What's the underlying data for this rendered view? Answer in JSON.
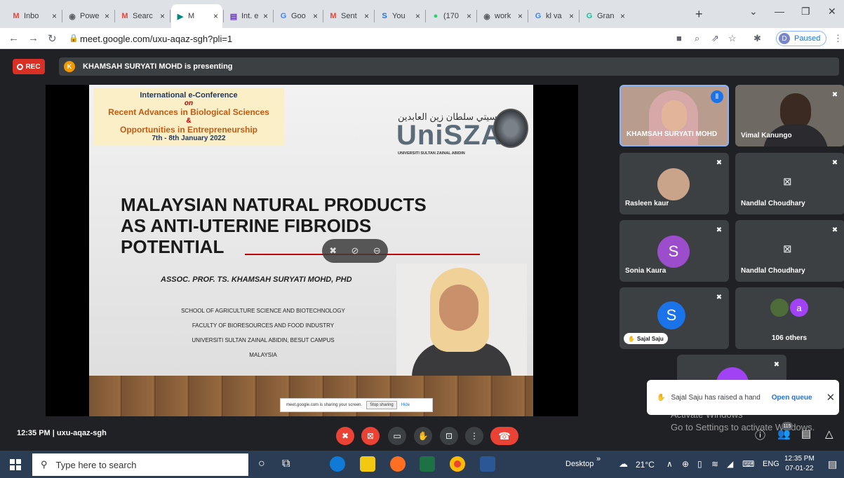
{
  "browser": {
    "tabs": [
      {
        "label": "Inbo",
        "icon": "gmail-icon",
        "color": "#ea4335",
        "glyph": "M"
      },
      {
        "label": "Powe",
        "icon": "chrome-globe-icon",
        "color": "#5f6368",
        "glyph": "◉"
      },
      {
        "label": "Searc",
        "icon": "gmail-icon",
        "color": "#ea4335",
        "glyph": "M"
      },
      {
        "label": "M",
        "icon": "meet-icon",
        "color": "#00897b",
        "glyph": "▶",
        "active": true
      },
      {
        "label": "Int. e",
        "icon": "forms-icon",
        "color": "#673ab7",
        "glyph": "▤"
      },
      {
        "label": "Goo",
        "icon": "google-icon",
        "color": "#4285f4",
        "glyph": "G"
      },
      {
        "label": "Sent",
        "icon": "gmail-icon",
        "color": "#ea4335",
        "glyph": "M"
      },
      {
        "label": "You",
        "icon": "sheet-icon",
        "color": "#1a73e8",
        "glyph": "S"
      },
      {
        "label": "(170",
        "icon": "whatsapp-icon",
        "color": "#25d366",
        "glyph": "●"
      },
      {
        "label": "work",
        "icon": "chrome-globe-icon",
        "color": "#5f6368",
        "glyph": "◉"
      },
      {
        "label": "kl va",
        "icon": "google-icon",
        "color": "#4285f4",
        "glyph": "G"
      },
      {
        "label": "Gran",
        "icon": "grammarly-icon",
        "color": "#15c39a",
        "glyph": "G"
      }
    ],
    "url": "meet.google.com/uxu-aqaz-sgh?pli=1",
    "profile_initial": "D",
    "profile_status": "Paused"
  },
  "meet": {
    "rec_label": "REC",
    "presenter_initial": "K",
    "presenting_text": "KHAMSAH SURYATI MOHD is presenting",
    "slide": {
      "conf_line1": "International e-Conference",
      "conf_line2": "on",
      "conf_line3": "Recent Advances in Biological Sciences",
      "conf_line4": "&",
      "conf_line5": "Opportunities in Entrepreneurship",
      "conf_line6": "7th - 8th January 2022",
      "logo_arabic": "يونيبرسيتي سلطان زين العابدين",
      "logo_text": "UniSZA",
      "logo_sub": "UNIVERSITI SULTAN ZAINAL ABIDIN",
      "title_line1": "MALAYSIAN NATURAL PRODUCTS",
      "title_line2": "AS ANTI-UTERINE FIBROIDS",
      "title_line3": "POTENTIAL",
      "author": "ASSOC. PROF. TS. KHAMSAH SURYATI MOHD, PHD",
      "aff1": "SCHOOL OF AGRICULTURE SCIENCE AND BIOTECHNOLOGY",
      "aff2": "FACULTY OF BIORESOURCES AND FOOD INDUSTRY",
      "aff3": "UNIVERSITI SULTAN ZAINAL ABIDIN, BESUT CAMPUS",
      "aff4": "MALAYSIA",
      "share_text": "meet.google.com is sharing your screen.",
      "share_stop": "Stop sharing",
      "share_hide": "Hide"
    },
    "participants": [
      {
        "name": "KHAMSAH SURYATI MOHD"
      },
      {
        "name": "Vimal Kanungo"
      },
      {
        "name": "Rasleen kaur"
      },
      {
        "name": "Nandlal Choudhary"
      },
      {
        "name": "Sonia Kaura",
        "initial": "S",
        "color": "#9c4dcc"
      },
      {
        "name": "Nandlal Choudhary"
      },
      {
        "name": "Sajal Saju",
        "initial": "S",
        "color": "#1a73e8"
      },
      {
        "name": "106 others",
        "initial": "a",
        "color": "#a142f4"
      }
    ],
    "toast_text": "Sajal Saju has raised a hand",
    "toast_action": "Open queue",
    "watermark_line1": "Activate Windows",
    "watermark_line2": "Go to Settings to activate Windows.",
    "time": "12:35 PM",
    "meeting_code": "uxu-aqaz-sgh",
    "people_count": "115"
  },
  "taskbar": {
    "search_placeholder": "Type here to search",
    "desktop_label": "Desktop",
    "weather": "21°C",
    "lang": "ENG",
    "clock_time": "12:35 PM",
    "clock_date": "07-01-22"
  }
}
